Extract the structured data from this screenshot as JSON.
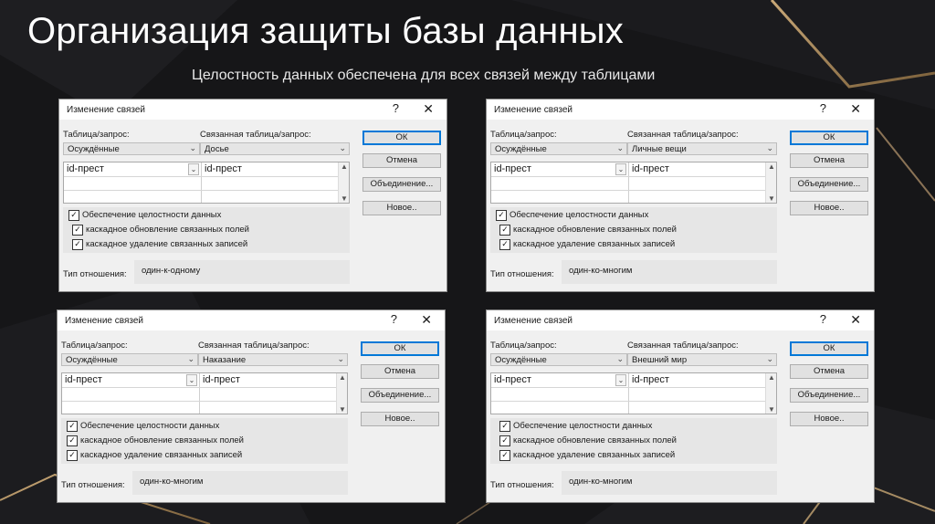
{
  "slide": {
    "title": "Организация защиты базы данных",
    "subtitle": "Целостность данных обеспечена для всех связей между таблицами"
  },
  "icons": {
    "help": "?",
    "close": "✕",
    "chevron_down": "⌄",
    "check": "✓",
    "scroll_up": "▲",
    "scroll_down": "▼"
  },
  "colors": {
    "background": "#141416",
    "dialog_bg": "#f0f0f0",
    "default_button_border": "#0078d7"
  },
  "dialogs": [
    {
      "title": "Изменение связей",
      "table_label": "Таблица/запрос:",
      "related_label": "Связанная таблица/запрос:",
      "table": "Осуждённые",
      "related_table": "Досье",
      "fields": [
        [
          "id-прест",
          "id-прест"
        ]
      ],
      "enforce_integrity": "Обеспечение целостности данных",
      "cascade_update": "каскадное обновление связанных полей",
      "cascade_delete": "каскадное удаление связанных записей",
      "relation_type_label": "Тип отношения:",
      "relation_type": "один-к-одному",
      "buttons": {
        "ok": "ОК",
        "cancel": "Отмена",
        "join": "Объединение...",
        "new": "Новое.."
      }
    },
    {
      "title": "Изменение связей",
      "table_label": "Таблица/запрос:",
      "related_label": "Связанная таблица/запрос:",
      "table": "Осуждённые",
      "related_table": "Личные вещи",
      "fields": [
        [
          "id-прест",
          "id-прест"
        ]
      ],
      "enforce_integrity": "Обеспечение целостности данных",
      "cascade_update": "каскадное обновление связанных полей",
      "cascade_delete": "каскадное удаление связанных записей",
      "relation_type_label": "Тип отношения:",
      "relation_type": "один-ко-многим",
      "buttons": {
        "ok": "ОК",
        "cancel": "Отмена",
        "join": "Объединение...",
        "new": "Новое.."
      }
    },
    {
      "title": "Изменение связей",
      "table_label": "Таблица/запрос:",
      "related_label": "Связанная таблица/запрос:",
      "table": "Осуждённые",
      "related_table": "Наказание",
      "fields": [
        [
          "id-прест",
          "id-прест"
        ]
      ],
      "enforce_integrity": "Обеспечение целостности данных",
      "cascade_update": "каскадное обновление связанных полей",
      "cascade_delete": "каскадное удаление связанных записей",
      "relation_type_label": "Тип отношения:",
      "relation_type": "один-ко-многим",
      "buttons": {
        "ok": "ОК",
        "cancel": "Отмена",
        "join": "Объединение...",
        "new": "Новое.."
      }
    },
    {
      "title": "Изменение связей",
      "table_label": "Таблица/запрос:",
      "related_label": "Связанная таблица/запрос:",
      "table": "Осуждённые",
      "related_table": "Внешний мир",
      "fields": [
        [
          "id-прест",
          "id-прест"
        ]
      ],
      "enforce_integrity": "Обеспечение целостности данных",
      "cascade_update": "каскадное обновление связанных полей",
      "cascade_delete": "каскадное удаление связанных записей",
      "relation_type_label": "Тип отношения:",
      "relation_type": "один-ко-многим",
      "buttons": {
        "ok": "ОК",
        "cancel": "Отмена",
        "join": "Объединение...",
        "new": "Новое.."
      }
    }
  ]
}
